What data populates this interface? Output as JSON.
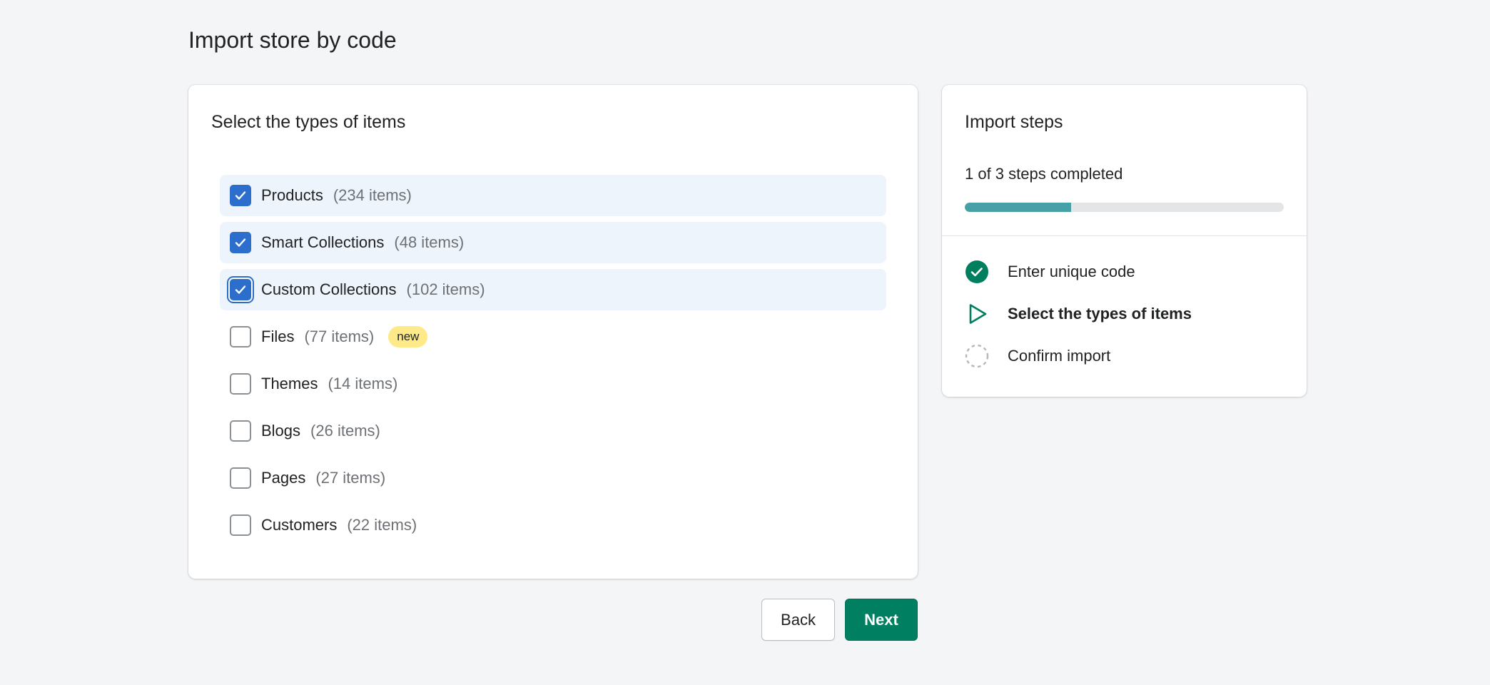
{
  "page": {
    "title": "Import store by code"
  },
  "selection": {
    "title": "Select the types of items",
    "items": [
      {
        "label": "Products",
        "count": "(234 items)",
        "checked": true,
        "badge": ""
      },
      {
        "label": "Smart Collections",
        "count": "(48 items)",
        "checked": true,
        "badge": ""
      },
      {
        "label": "Custom Collections",
        "count": "(102 items)",
        "checked": true,
        "badge": ""
      },
      {
        "label": "Files",
        "count": "(77 items)",
        "checked": false,
        "badge": "new"
      },
      {
        "label": "Themes",
        "count": "(14 items)",
        "checked": false,
        "badge": ""
      },
      {
        "label": "Blogs",
        "count": "(26 items)",
        "checked": false,
        "badge": ""
      },
      {
        "label": "Pages",
        "count": "(27 items)",
        "checked": false,
        "badge": ""
      },
      {
        "label": "Customers",
        "count": "(22 items)",
        "checked": false,
        "badge": ""
      }
    ]
  },
  "steps": {
    "title": "Import steps",
    "progress_text": "1 of 3 steps completed",
    "progress_fraction": 0.333,
    "list": [
      {
        "label": "Enter unique code",
        "status": "completed",
        "icon": "check-circle-icon"
      },
      {
        "label": "Select the types of items",
        "status": "current",
        "icon": "play-icon"
      },
      {
        "label": "Confirm import",
        "status": "pending",
        "icon": "dashed-circle-icon"
      }
    ]
  },
  "actions": {
    "back_label": "Back",
    "next_label": "Next"
  },
  "colors": {
    "primary": "#008060",
    "checkbox": "#2c6ecb",
    "progress": "#47a0a5",
    "badge": "#ffea8a"
  }
}
